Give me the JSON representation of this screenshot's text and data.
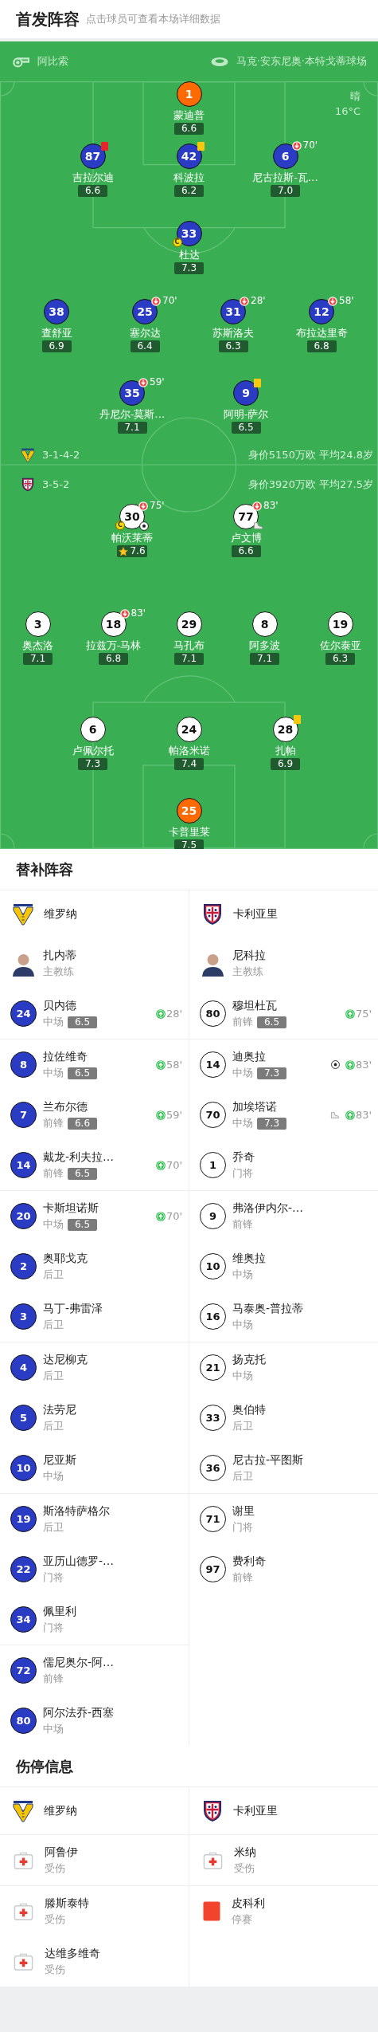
{
  "header": {
    "title": "首发阵容",
    "hint": "点击球员可查看本场详细数据"
  },
  "pitch": {
    "referee": "阿比索",
    "stadium": "马克·安东尼奥·本特戈蒂球场",
    "weather": "晴",
    "temperature": "16°C",
    "home": {
      "formation": "3-1-4-2",
      "summary": "身价5150万欧 平均24.8岁",
      "lines": [
        {
          "players": [
            {
              "number": "1",
              "name": "蒙迪普",
              "rating": "6.6",
              "kind": "keeper"
            }
          ]
        },
        {
          "players": [
            {
              "number": "87",
              "name": "吉拉尔迪",
              "rating": "6.6",
              "kind": "outfield",
              "marks": [
                {
                  "kind": "red_card"
                }
              ]
            },
            {
              "number": "42",
              "name": "科波拉",
              "rating": "6.2",
              "kind": "outfield",
              "marks": [
                {
                  "kind": "yellow_card"
                }
              ]
            },
            {
              "number": "6",
              "name": "尼古拉斯-瓦…",
              "rating": "7.0",
              "kind": "outfield",
              "marks": [
                {
                  "kind": "sub_out",
                  "minute": "70'"
                }
              ]
            }
          ]
        },
        {
          "players": [
            {
              "number": "33",
              "name": "杜达",
              "rating": "7.3",
              "kind": "outfield",
              "marks": [
                {
                  "kind": "captain",
                  "label": "C"
                }
              ]
            }
          ]
        },
        {
          "players": [
            {
              "number": "38",
              "name": "查舒亚",
              "rating": "6.9",
              "kind": "outfield"
            },
            {
              "number": "25",
              "name": "塞尔达",
              "rating": "6.4",
              "kind": "outfield",
              "marks": [
                {
                  "kind": "sub_out",
                  "minute": "70'"
                }
              ]
            },
            {
              "number": "31",
              "name": "苏斯洛夫",
              "rating": "6.3",
              "kind": "outfield",
              "marks": [
                {
                  "kind": "sub_out",
                  "minute": "28'"
                }
              ]
            },
            {
              "number": "12",
              "name": "布拉达里奇",
              "rating": "6.8",
              "kind": "outfield",
              "marks": [
                {
                  "kind": "sub_out",
                  "minute": "58'"
                }
              ]
            }
          ]
        },
        {
          "players": [
            {
              "number": "35",
              "name": "丹尼尔-莫斯…",
              "rating": "7.1",
              "kind": "outfield",
              "marks": [
                {
                  "kind": "sub_out",
                  "minute": "59'"
                }
              ]
            },
            {
              "number": "9",
              "name": "阿明-萨尔",
              "rating": "6.5",
              "kind": "outfield",
              "marks": [
                {
                  "kind": "yellow_card"
                }
              ]
            }
          ]
        }
      ]
    },
    "away": {
      "formation": "3-5-2",
      "summary": "身价3920万欧 平均27.5岁",
      "lines": [
        {
          "players": [
            {
              "number": "30",
              "name": "帕沃莱蒂",
              "rating": "7.6",
              "kind": "outfield",
              "marks": [
                {
                  "kind": "sub_out",
                  "minute": "75'"
                },
                {
                  "kind": "captain",
                  "label": "C"
                },
                {
                  "kind": "goal"
                },
                {
                  "kind": "mvp"
                }
              ]
            },
            {
              "number": "77",
              "name": "卢文博",
              "rating": "6.6",
              "kind": "outfield",
              "marks": [
                {
                  "kind": "sub_out",
                  "minute": "83'"
                },
                {
                  "kind": "assist"
                }
              ]
            }
          ]
        },
        {
          "players": [
            {
              "number": "3",
              "name": "奥杰洛",
              "rating": "7.1",
              "kind": "outfield"
            },
            {
              "number": "18",
              "name": "拉兹万-马林",
              "rating": "6.8",
              "kind": "outfield",
              "marks": [
                {
                  "kind": "sub_out",
                  "minute": "83'"
                }
              ]
            },
            {
              "number": "29",
              "name": "马孔布",
              "rating": "7.1",
              "kind": "outfield"
            },
            {
              "number": "8",
              "name": "阿多波",
              "rating": "7.1",
              "kind": "outfield"
            },
            {
              "number": "19",
              "name": "佐尔泰亚",
              "rating": "6.3",
              "kind": "outfield"
            }
          ]
        },
        {
          "players": [
            {
              "number": "6",
              "name": "卢佩尔托",
              "rating": "7.3",
              "kind": "outfield"
            },
            {
              "number": "24",
              "name": "帕洛米诺",
              "rating": "7.4",
              "kind": "outfield"
            },
            {
              "number": "28",
              "name": "扎帕",
              "rating": "6.9",
              "kind": "outfield",
              "marks": [
                {
                  "kind": "yellow_card"
                }
              ]
            }
          ]
        },
        {
          "players": [
            {
              "number": "25",
              "name": "卡普里莱",
              "rating": "7.5",
              "kind": "keeper"
            }
          ]
        }
      ]
    }
  },
  "substitutes": {
    "title": "替补阵容",
    "teams": [
      {
        "name": "维罗纳",
        "coach": {
          "name": "扎内蒂",
          "role": "主教练"
        },
        "players": [
          {
            "number": "24",
            "name": "贝内德",
            "position": "中场",
            "rating": "6.5",
            "events": [
              {
                "kind": "sub_in",
                "minute": "28'"
              }
            ]
          },
          {
            "number": "8",
            "name": "拉佐维奇",
            "position": "中场",
            "rating": "6.5",
            "events": [
              {
                "kind": "sub_in",
                "minute": "58'"
              }
            ]
          },
          {
            "number": "7",
            "name": "兰布尔德",
            "position": "前锋",
            "rating": "6.6",
            "events": [
              {
                "kind": "sub_in",
                "minute": "59'"
              }
            ]
          },
          {
            "number": "14",
            "name": "戴龙-利夫拉…",
            "position": "前锋",
            "rating": "6.5",
            "events": [
              {
                "kind": "sub_in",
                "minute": "70'"
              }
            ]
          },
          {
            "number": "20",
            "name": "卡斯坦诺斯",
            "position": "中场",
            "rating": "6.5",
            "events": [
              {
                "kind": "sub_in",
                "minute": "70'"
              }
            ]
          },
          {
            "number": "2",
            "name": "奥耶戈克",
            "position": "后卫"
          },
          {
            "number": "3",
            "name": "马丁-弗雷泽",
            "position": "后卫"
          },
          {
            "number": "4",
            "name": "达尼柳克",
            "position": "后卫"
          },
          {
            "number": "5",
            "name": "法劳尼",
            "position": "后卫"
          },
          {
            "number": "10",
            "name": "尼亚斯",
            "position": "中场"
          },
          {
            "number": "19",
            "name": "斯洛特萨格尔",
            "position": "后卫"
          },
          {
            "number": "22",
            "name": "亚历山德罗-…",
            "position": "门将"
          },
          {
            "number": "34",
            "name": "佩里利",
            "position": "门将"
          },
          {
            "number": "72",
            "name": "儒尼奥尔-阿…",
            "position": "前锋"
          },
          {
            "number": "80",
            "name": "阿尔法乔-西塞",
            "position": "中场"
          }
        ]
      },
      {
        "name": "卡利亚里",
        "coach": {
          "name": "尼科拉",
          "role": "主教练"
        },
        "players": [
          {
            "number": "80",
            "name": "穆坦杜瓦",
            "position": "前锋",
            "rating": "6.5",
            "events": [
              {
                "kind": "sub_in",
                "minute": "75'"
              }
            ]
          },
          {
            "number": "14",
            "name": "迪奥拉",
            "position": "中场",
            "rating": "7.3",
            "events": [
              {
                "kind": "goal"
              },
              {
                "kind": "sub_in",
                "minute": "83'"
              }
            ]
          },
          {
            "number": "70",
            "name": "加埃塔诺",
            "position": "中场",
            "rating": "7.3",
            "events": [
              {
                "kind": "assist"
              },
              {
                "kind": "sub_in",
                "minute": "83'"
              }
            ]
          },
          {
            "number": "1",
            "name": "乔奇",
            "position": "门将"
          },
          {
            "number": "9",
            "name": "弗洛伊内尔-…",
            "position": "前锋"
          },
          {
            "number": "10",
            "name": "维奥拉",
            "position": "中场"
          },
          {
            "number": "16",
            "name": "马泰奥-普拉蒂",
            "position": "中场"
          },
          {
            "number": "21",
            "name": "扬克托",
            "position": "中场"
          },
          {
            "number": "33",
            "name": "奥伯特",
            "position": "后卫"
          },
          {
            "number": "36",
            "name": "尼古拉-平图斯",
            "position": "后卫"
          },
          {
            "number": "71",
            "name": "谢里",
            "position": "门将"
          },
          {
            "number": "97",
            "name": "费利奇",
            "position": "前锋"
          }
        ]
      }
    ]
  },
  "injuries": {
    "title": "伤停信息",
    "teams": [
      {
        "name": "维罗纳",
        "players": [
          {
            "name": "阿鲁伊",
            "status": "受伤",
            "kind": "injury"
          },
          {
            "name": "滕斯泰特",
            "status": "受伤",
            "kind": "injury"
          },
          {
            "name": "达维多维奇",
            "status": "受伤",
            "kind": "injury"
          }
        ]
      },
      {
        "name": "卡利亚里",
        "players": [
          {
            "name": "米纳",
            "status": "受伤",
            "kind": "injury"
          },
          {
            "name": "皮科利",
            "status": "停赛",
            "kind": "suspension"
          }
        ]
      }
    ]
  }
}
